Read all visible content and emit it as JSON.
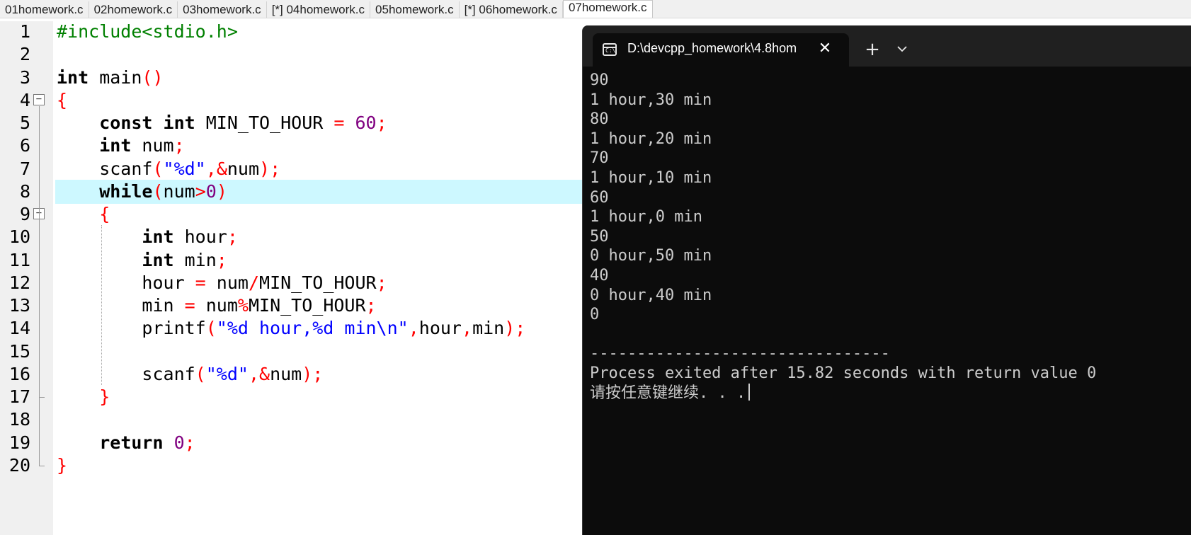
{
  "tabs": [
    {
      "label": "01homework.c",
      "active": false
    },
    {
      "label": "02homework.c",
      "active": false
    },
    {
      "label": "03homework.c",
      "active": false
    },
    {
      "label": "[*] 04homework.c",
      "active": false
    },
    {
      "label": "05homework.c",
      "active": false
    },
    {
      "label": "[*] 06homework.c",
      "active": false
    },
    {
      "label": "07homework.c",
      "active": true
    }
  ],
  "editor": {
    "highlighted_line": 8,
    "colors": {
      "keyword": "#000000",
      "preprocessor": "#008000",
      "operator": "#ff0000",
      "number": "#800080",
      "string": "#0000ff",
      "highlight": "#cdf8ff"
    },
    "lines": [
      {
        "n": "1",
        "text": "#include<stdio.h>"
      },
      {
        "n": "2",
        "text": ""
      },
      {
        "n": "3",
        "text": "int main()"
      },
      {
        "n": "4",
        "text": "{"
      },
      {
        "n": "5",
        "text": "    const int MIN_TO_HOUR = 60;"
      },
      {
        "n": "6",
        "text": "    int num;"
      },
      {
        "n": "7",
        "text": "    scanf(\"%d\",&num);"
      },
      {
        "n": "8",
        "text": "    while(num>0)"
      },
      {
        "n": "9",
        "text": "    {"
      },
      {
        "n": "10",
        "text": "        int hour;"
      },
      {
        "n": "11",
        "text": "        int min;"
      },
      {
        "n": "12",
        "text": "        hour = num/MIN_TO_HOUR;"
      },
      {
        "n": "13",
        "text": "        min = num%MIN_TO_HOUR;"
      },
      {
        "n": "14",
        "text": "        printf(\"%d hour,%d min\\n\",hour,min);"
      },
      {
        "n": "15",
        "text": ""
      },
      {
        "n": "16",
        "text": "        scanf(\"%d\",&num);"
      },
      {
        "n": "17",
        "text": "    }"
      },
      {
        "n": "18",
        "text": ""
      },
      {
        "n": "19",
        "text": "    return 0;"
      },
      {
        "n": "20",
        "text": "}"
      }
    ]
  },
  "terminal": {
    "tab_title": "D:\\devcpp_homework\\4.8hom",
    "tab_icon": "console-icon",
    "close_label": "✕",
    "new_tab_label": "+",
    "dropdown_icon": "chevron-down-icon",
    "output_lines": [
      "90",
      "1 hour,30 min",
      "80",
      "1 hour,20 min",
      "70",
      "1 hour,10 min",
      "60",
      "1 hour,0 min",
      "50",
      "0 hour,50 min",
      "40",
      "0 hour,40 min",
      "0",
      "",
      "--------------------------------",
      "Process exited after 15.82 seconds with return value 0",
      "请按任意键继续. . ."
    ]
  }
}
